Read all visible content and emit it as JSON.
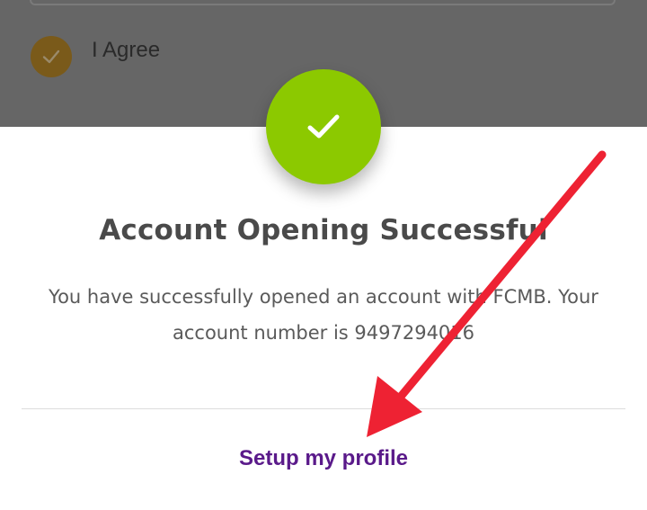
{
  "background": {
    "agree_label": "I Agree",
    "agree_checked": true
  },
  "modal": {
    "icon": "check-icon",
    "title": "Account Opening Successful",
    "message": "You have successfully opened an account with FCMB. Your account number is 9497294016",
    "cta_label": "Setup my profile"
  },
  "annotation": {
    "icon": "red-arrow",
    "color": "#ee2233"
  },
  "colors": {
    "success": "#8cc900",
    "cta": "#5a1a8a",
    "backdrop": "#666666"
  }
}
